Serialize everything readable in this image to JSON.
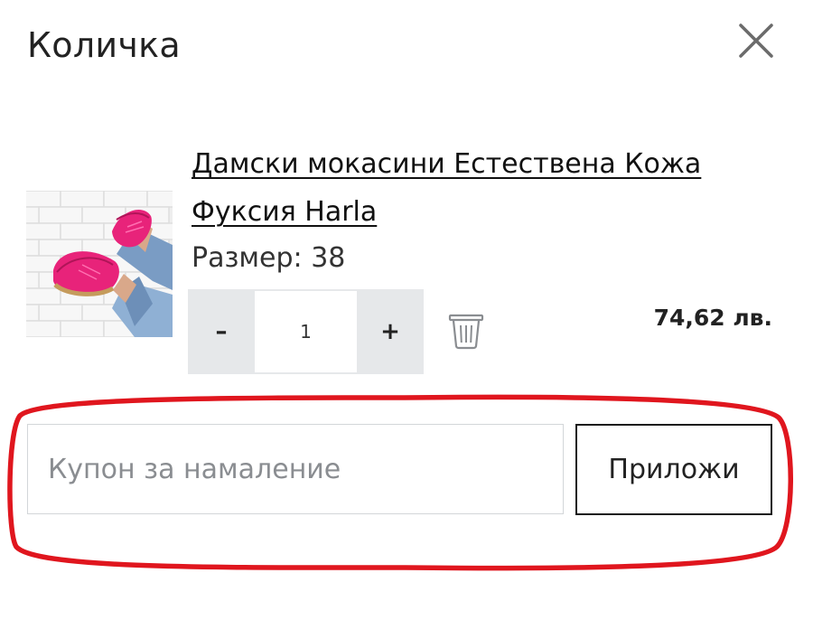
{
  "cart": {
    "title": "Количка",
    "close_icon": "close-icon"
  },
  "item": {
    "title": "Дамски мокасини Естествена Кожа Фуксия Harla",
    "size_text": "Размер: 38",
    "quantity": "1",
    "decrease_label": "–",
    "increase_label": "+",
    "price": "74,62 лв.",
    "delete_icon": "trash-icon",
    "image_icon": "product-image"
  },
  "coupon": {
    "placeholder": "Купон за намаление",
    "value": "",
    "apply_label": "Приложи"
  },
  "colors": {
    "highlight": "#e0161e",
    "qty_bg": "#e6e8ea",
    "product_pink": "#e8237a"
  }
}
